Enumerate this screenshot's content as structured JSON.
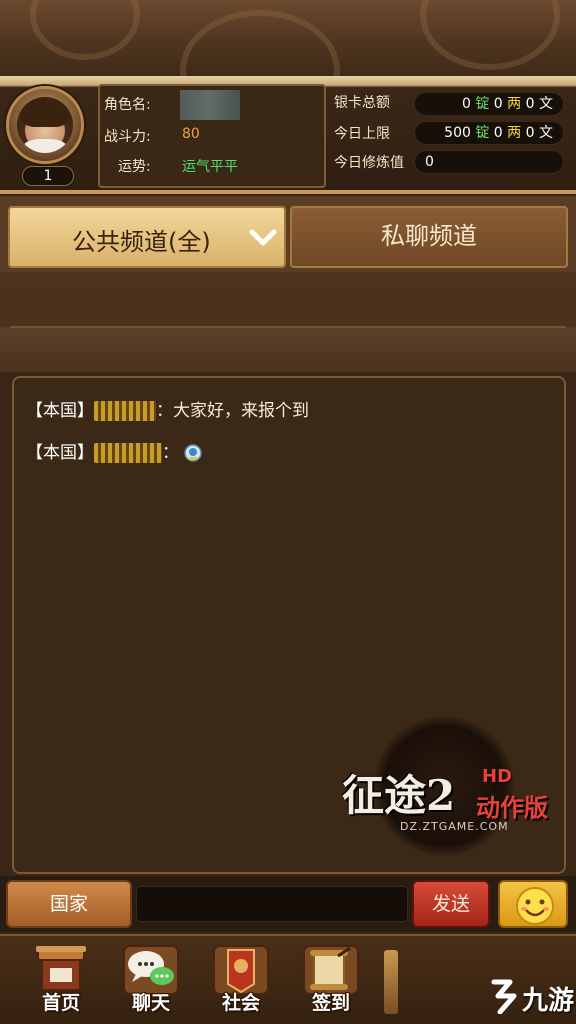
{
  "profile": {
    "level": "1",
    "name_label": "角色名:",
    "power_label": "战斗力:",
    "power_value": "80",
    "luck_label": "运势:",
    "luck_value": "运气平平"
  },
  "currency": {
    "bank_total_label": "银卡总额",
    "daily_limit_label": "今日上限",
    "cultivation_label": "今日修炼值",
    "bank_total": {
      "ding": "0",
      "liang": "0",
      "wen": "0"
    },
    "daily_limit": {
      "ding": "500",
      "liang": "0",
      "wen": "0"
    },
    "cultivation_value": "0",
    "unit_ding": "锭",
    "unit_liang": "两",
    "unit_wen": "文"
  },
  "tabs": {
    "public_label": "公共频道(全)",
    "private_label": "私聊频道"
  },
  "chat": {
    "messages": [
      {
        "channel": "【本国】",
        "text": "：大家好，来报个到"
      },
      {
        "channel": "【本国】",
        "text": "："
      }
    ]
  },
  "logo": {
    "title": "征途2",
    "hd": "HD",
    "subtitle": "动作版",
    "url": "DZ.ZTGAME.COM"
  },
  "input_bar": {
    "country_label": "国家",
    "message_value": "",
    "send_label": "发送"
  },
  "nav": {
    "items": [
      {
        "label": "首页",
        "icon": "home-icon"
      },
      {
        "label": "聊天",
        "icon": "chat-icon"
      },
      {
        "label": "社会",
        "icon": "society-icon"
      },
      {
        "label": "签到",
        "icon": "checkin-icon"
      }
    ]
  },
  "watermark": {
    "text": "九游"
  },
  "colors": {
    "luck_green": "#4ee36a",
    "power_orange": "#f0a23a",
    "send_red": "#c8392a",
    "emoji_yellow": "#f5c246"
  }
}
